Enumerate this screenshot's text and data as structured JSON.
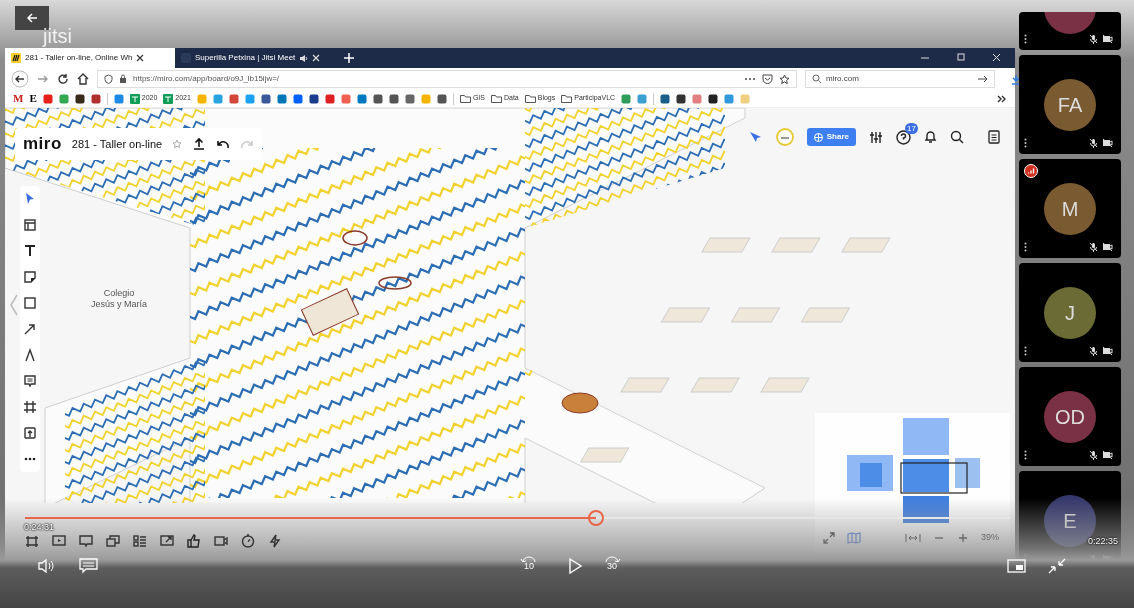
{
  "player": {
    "logo": "jitsi",
    "elapsed": "0:24:31",
    "remaining": "0:22:35",
    "progress": {
      "level": 0.58
    },
    "rewind": "10",
    "forward": "30"
  },
  "browser": {
    "tabs": [
      {
        "title": "281 - Taller on-line, Online Wh",
        "selected": true
      },
      {
        "title": "Superilla Petxina | Jitsi Meet",
        "selected": false
      }
    ],
    "url": "https://miro.com/app/board/o9J_lb15ijw=/",
    "search": {
      "value": "miro.com"
    },
    "bookmarks": [
      {
        "kind": "letter",
        "label": "M",
        "color": "#c5221f"
      },
      {
        "kind": "letter",
        "label": "E",
        "color": "#000000"
      },
      {
        "kind": "icon",
        "color": "#e62117"
      },
      {
        "kind": "icon",
        "color": "#34a853"
      },
      {
        "kind": "icon",
        "color": "#3a2a1a"
      },
      {
        "kind": "icon",
        "color": "#b03030"
      },
      {
        "kind": "separator"
      },
      {
        "kind": "icon",
        "color": "#1e88e5"
      },
      {
        "kind": "labeled",
        "label": "2020",
        "color": "#0f9d58"
      },
      {
        "kind": "labeled",
        "label": "2021",
        "color": "#0f9d58"
      },
      {
        "kind": "icon",
        "color": "#f4b400"
      },
      {
        "kind": "icon",
        "color": "#29a3e0"
      },
      {
        "kind": "icon",
        "color": "#d44638"
      },
      {
        "kind": "icon",
        "color": "#1da1f2"
      },
      {
        "kind": "icon",
        "color": "#3b5998"
      },
      {
        "kind": "icon",
        "color": "#0077b5"
      },
      {
        "kind": "icon",
        "color": "#0061ff"
      },
      {
        "kind": "icon",
        "color": "#1a3c8c"
      },
      {
        "kind": "icon",
        "color": "#e02020"
      },
      {
        "kind": "icon",
        "color": "#f06050"
      },
      {
        "kind": "icon",
        "color": "#0079bf"
      },
      {
        "kind": "icon",
        "color": "#555555"
      },
      {
        "kind": "icon",
        "color": "#555555"
      },
      {
        "kind": "icon",
        "color": "#666666"
      },
      {
        "kind": "icon",
        "color": "#f4b400"
      },
      {
        "kind": "icon",
        "color": "#555555"
      },
      {
        "kind": "separator"
      },
      {
        "kind": "folder",
        "label": "GIS"
      },
      {
        "kind": "folder",
        "label": "Data"
      },
      {
        "kind": "folder",
        "label": "Blogs"
      },
      {
        "kind": "folder",
        "label": "ParticipaVLC"
      },
      {
        "kind": "icon",
        "color": "#2e9d5a"
      },
      {
        "kind": "icon",
        "color": "#3aa0d0"
      },
      {
        "kind": "separator"
      },
      {
        "kind": "icon",
        "color": "#1b5e8a"
      },
      {
        "kind": "icon",
        "color": "#333333"
      },
      {
        "kind": "icon",
        "color": "#e08080"
      },
      {
        "kind": "icon",
        "color": "#222222"
      },
      {
        "kind": "icon",
        "color": "#3399dd"
      },
      {
        "kind": "icon",
        "color": "#f0d080"
      }
    ]
  },
  "board": {
    "logo": "miro",
    "title": "281 - Taller on-line",
    "share": "Share",
    "notifications": "17",
    "label": "Colegio\nJesús y María",
    "zoom": "39%"
  },
  "participants": [
    {
      "color": "#7a3045",
      "connection_warning": false
    },
    {
      "initials": "FA",
      "color": "#7a5a30",
      "connection_warning": false
    },
    {
      "initials": "M",
      "color": "#7a5a30",
      "connection_warning": true
    },
    {
      "initials": "J",
      "color": "#6b6b35",
      "connection_warning": false
    },
    {
      "initials": "OD",
      "color": "#7a3045",
      "connection_warning": false
    },
    {
      "initials": "E",
      "color": "#35386b",
      "connection_warning": false
    }
  ]
}
